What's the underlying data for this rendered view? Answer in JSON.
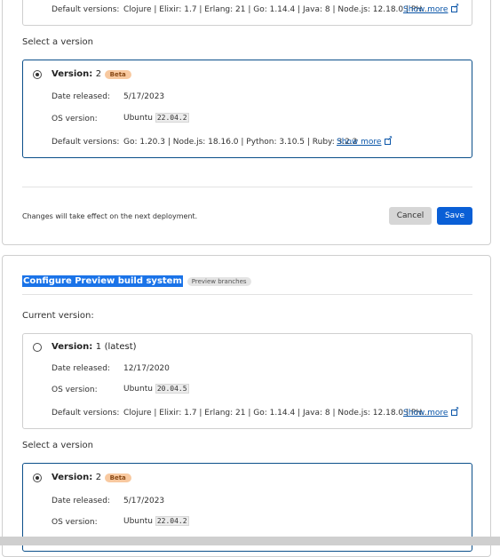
{
  "top": {
    "partial_card": {
      "default_label": "Default versions:",
      "default_value": "Clojure | Elixir: 1.7 | Erlang: 21 | Go: 1.14.4 | Java: 8 | Node.js: 12.18.0 | PH...",
      "show_more": "Show more"
    },
    "select_label": "Select a version",
    "card": {
      "version_label": "Version:",
      "version_number": "2",
      "badge": "Beta",
      "date_label": "Date released:",
      "date_value": "5/17/2023",
      "os_label": "OS version:",
      "os_name": "Ubuntu",
      "os_code": "22.04.2",
      "default_label": "Default versions:",
      "default_value": "Go: 1.20.3 | Node.js: 18.16.0 | Python: 3.10.5 | Ruby: 3.2.2",
      "show_more": "Show more"
    },
    "footer_note": "Changes will take effect on the next deployment.",
    "cancel": "Cancel",
    "save": "Save"
  },
  "preview": {
    "title": "Configure Preview build system",
    "badge": "Preview branches",
    "current_label": "Current version:",
    "current_card": {
      "version_label": "Version:",
      "version_number": "1",
      "version_suffix": "(latest)",
      "date_label": "Date released:",
      "date_value": "12/17/2020",
      "os_label": "OS version:",
      "os_name": "Ubuntu",
      "os_code": "20.04.5",
      "default_label": "Default versions:",
      "default_value": "Clojure | Elixir: 1.7 | Erlang: 21 | Go: 1.14.4 | Java: 8 | Node.js: 12.18.0 | PH...",
      "show_more": "Show more"
    },
    "select_label": "Select a version",
    "card": {
      "version_label": "Version:",
      "version_number": "2",
      "badge": "Beta",
      "date_label": "Date released:",
      "date_value": "5/17/2023",
      "os_label": "OS version:",
      "os_name": "Ubuntu",
      "os_code": "22.04.2"
    }
  }
}
